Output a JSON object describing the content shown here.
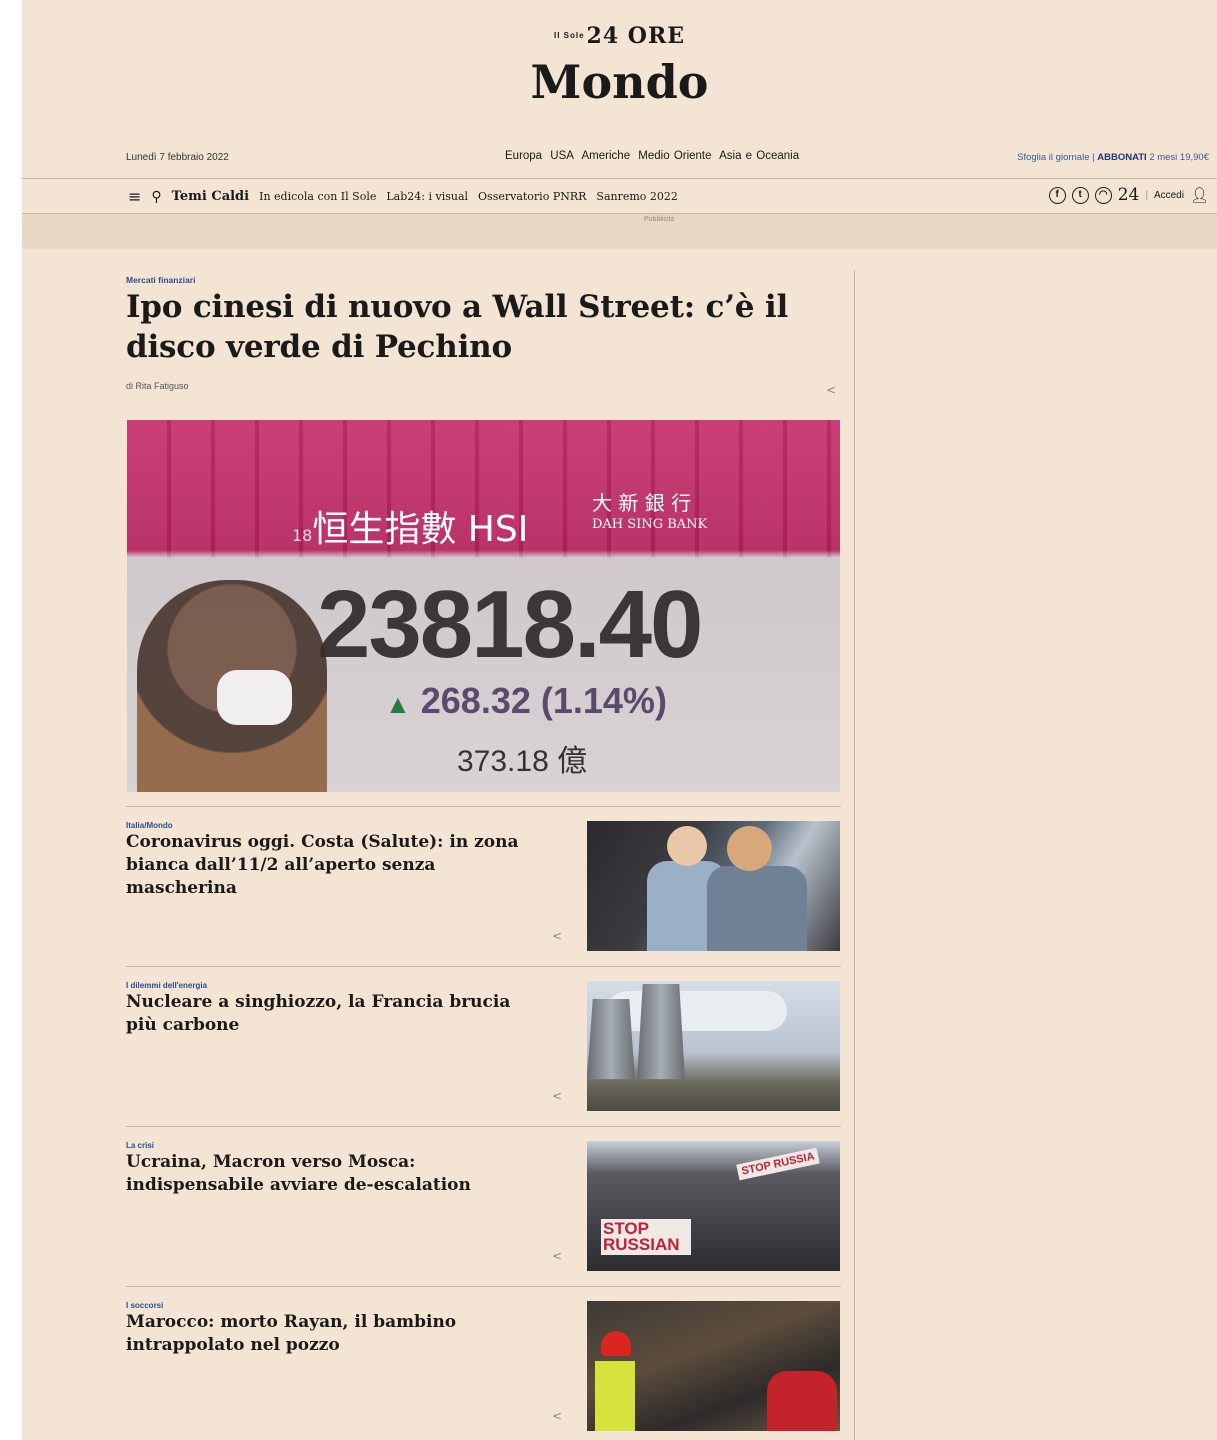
{
  "header": {
    "logo_prefix": "Il Sole",
    "logo": "24 ORE",
    "section_title": "Mondo",
    "date": "Lunedì 7 febbraio 2022",
    "regions": [
      "Europa",
      "USA",
      "Americhe",
      "Medio Oriente",
      "Asia e Oceania"
    ],
    "subscribe": {
      "browse": "Sfoglia il giornale",
      "separator": "|",
      "cta": "ABBONATI",
      "offer": "2 mesi 19,90€"
    }
  },
  "nav": {
    "hot_topics": "Temi Caldi",
    "items": [
      "In edicola con Il Sole",
      "Lab24: i visual",
      "Osservatorio PNRR",
      "Sanremo 2022"
    ],
    "num": "24",
    "login": "Accedi",
    "icons": [
      "menu-icon",
      "search-icon",
      "facebook-icon",
      "twitter-icon",
      "radio-icon",
      "user-icon"
    ]
  },
  "ad": {
    "label": "Pubblicità"
  },
  "lead": {
    "kicker": "Mercati finanziari",
    "title": "Ipo cinesi di nuovo a Wall Street: c’è il disco verde di Pechino",
    "byline": "di Rita Fatiguso",
    "image": {
      "index_name": "恒生指數 HSI",
      "prefix_digits": "18",
      "bank": "大 新 銀 行",
      "bank_en": "DAH SING BANK",
      "value": "23818.40",
      "change": "268.32",
      "change_pct": "(1.14%)",
      "volume": "373.18 億"
    }
  },
  "stories": [
    {
      "kicker": "Italia/Mondo",
      "title": "Coronavirus oggi. Costa (Salute): in zona bianca dall’11/2 all’aperto senza mascherina"
    },
    {
      "kicker": "I dilemmi dell'energia",
      "title": "Nucleare a singhiozzo, la Francia brucia più carbone"
    },
    {
      "kicker": "La crisi",
      "title": "Ucraina, Macron verso Mosca: indispensabile avviare de-escalation",
      "signs": [
        "STOP RUSSIA",
        "STOP RUSSIAN"
      ]
    },
    {
      "kicker": "I soccorsi",
      "title": "Marocco: morto Rayan, il bambino intrappolato nel pozzo"
    }
  ],
  "share_glyph": "<"
}
